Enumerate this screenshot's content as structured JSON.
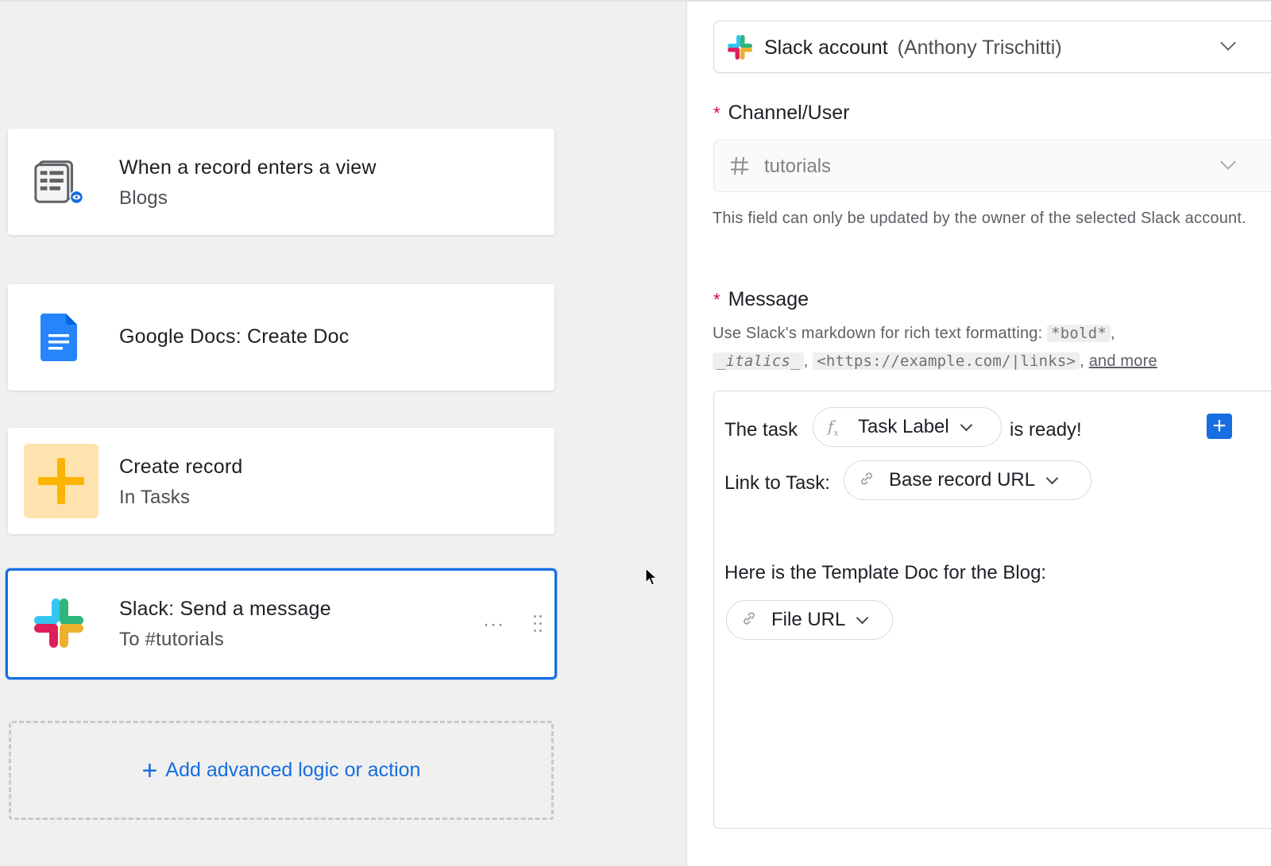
{
  "workflow": {
    "trigger": {
      "title": "When a record enters a view",
      "subtitle": "Blogs",
      "icon": "record-view-icon"
    },
    "actions": [
      {
        "title": "Google Docs: Create Doc",
        "subtitle": "",
        "icon": "google-docs-icon"
      },
      {
        "title": "Create record",
        "subtitle": "In Tasks",
        "icon": "plus-icon"
      },
      {
        "title": "Slack: Send a message",
        "subtitle": "To #tutorials",
        "icon": "slack-icon",
        "menu": "···"
      }
    ],
    "add_action_label": "Add advanced logic or action"
  },
  "config": {
    "account": {
      "label": "Slack account",
      "owner": "(Anthony Trischitti)"
    },
    "channel": {
      "label": "Channel/User",
      "required_marker": "*",
      "value": "tutorials",
      "help": "This field can only be updated by the owner of the selected Slack account."
    },
    "message": {
      "label": "Message",
      "required_marker": "*",
      "help_prefix": "Use Slack's markdown for rich text formatting:",
      "help_bold": "*bold*",
      "help_italics": "_italics_",
      "help_links": "<https://example.com/|links>",
      "help_more": "and more",
      "line1_before": "The task",
      "token1": "Task Label",
      "line1_after": "is ready!",
      "line2_before": "Link to Task:",
      "token2": "Base record URL",
      "line3": "Here is the Template Doc for the Blog:",
      "token3": "File URL"
    }
  },
  "colors": {
    "accent": "#166ee1",
    "required": "#dc043b",
    "create_record_bg": "#ffe3ae",
    "create_record_fg": "#fcb400"
  }
}
